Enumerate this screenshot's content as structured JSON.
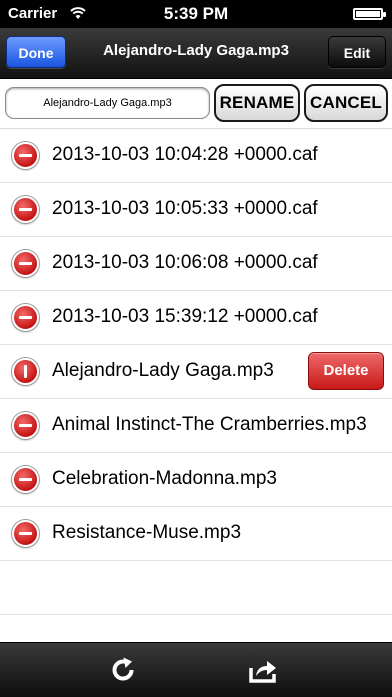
{
  "status_bar": {
    "carrier": "Carrier",
    "time": "5:39 PM"
  },
  "nav": {
    "done_label": "Done",
    "title": "Alejandro-Lady Gaga.mp3",
    "edit_label": "Edit"
  },
  "rename": {
    "value": "Alejandro-Lady Gaga.mp3",
    "rename_label": "RENAME",
    "cancel_label": "CANCEL"
  },
  "files": [
    {
      "name": "2013-10-03 10:04:28 +0000.caf"
    },
    {
      "name": "2013-10-03 10:05:33 +0000.caf"
    },
    {
      "name": "2013-10-03 10:06:08 +0000.caf"
    },
    {
      "name": "2013-10-03 15:39:12 +0000.caf"
    },
    {
      "name": "Alejandro-Lady Gaga.mp3"
    },
    {
      "name": "Animal Instinct-The Cramberries.mp3"
    },
    {
      "name": "Celebration-Madonna.mp3"
    },
    {
      "name": "Resistance-Muse.mp3"
    }
  ],
  "row_delete_label": "Delete",
  "toolbar": {
    "refresh_icon": "refresh-icon",
    "share_icon": "share-icon"
  },
  "colors": {
    "nav_bar": "#1e1e1e",
    "done_button": "#2a62ea",
    "delete_red": "#d42020"
  }
}
